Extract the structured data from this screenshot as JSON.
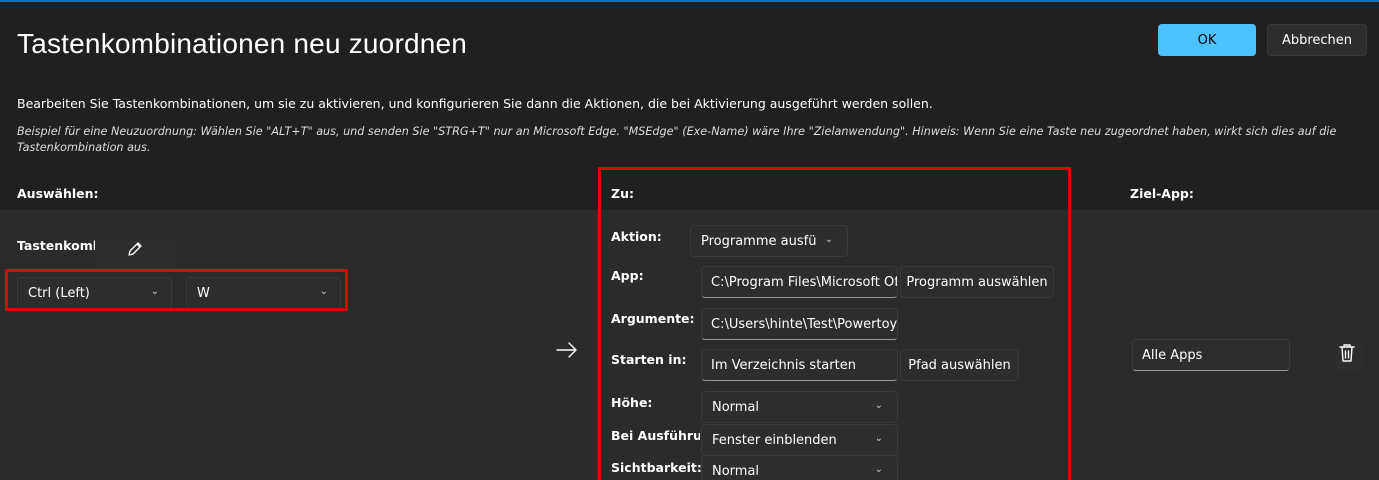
{
  "header": {
    "title": "Tastenkombinationen neu zuordnen",
    "ok_label": "OK",
    "cancel_label": "Abbrechen"
  },
  "description": "Bearbeiten Sie Tastenkombinationen, um sie zu aktivieren, und konfigurieren Sie dann die Aktionen, die bei Aktivierung ausgeführt werden sollen.",
  "example": "Beispiel für eine Neuzuordnung: Wählen Sie \"ALT+T\" aus, und senden Sie \"STRG+T\" nur an Microsoft Edge. \"MSEdge\" (Exe-Name) wäre Ihre \"Zielanwendung\". Hinweis: Wenn Sie eine Taste neu zugeordnet haben, wirkt sich dies auf die Tastenkombination aus.",
  "columns": {
    "select": "Auswählen:",
    "to": "Zu:",
    "target_app": "Ziel-App:"
  },
  "select": {
    "shortcut_label": "Tastenkomb",
    "key1": "Ctrl (Left)",
    "key2": "W"
  },
  "to": {
    "action_label": "Aktion:",
    "action_value": "Programme ausfü",
    "app_label": "App:",
    "app_value": "C:\\Program Files\\Microsoft Of",
    "app_button": "Programm auswählen",
    "args_label": "Argumente:",
    "args_value": "C:\\Users\\hinte\\Test\\Powertoys",
    "start_label": "Starten in:",
    "start_placeholder": "Im Verzeichnis starten",
    "start_button": "Pfad auswählen",
    "height_label": "Höhe:",
    "height_value": "Normal",
    "run_label": "Bei Ausführung",
    "run_value": "Fenster einblenden",
    "visibility_label": "Sichtbarkeit:",
    "visibility_value": "Normal"
  },
  "target": {
    "app_value": "Alle Apps"
  },
  "icons": {
    "edit": "pencil-icon",
    "arrow": "arrow-right-icon",
    "delete": "trash-icon",
    "chevron": "chevron-down-icon"
  },
  "colors": {
    "accent": "#4cc2ff",
    "highlight": "#e00000",
    "background": "#202020"
  }
}
